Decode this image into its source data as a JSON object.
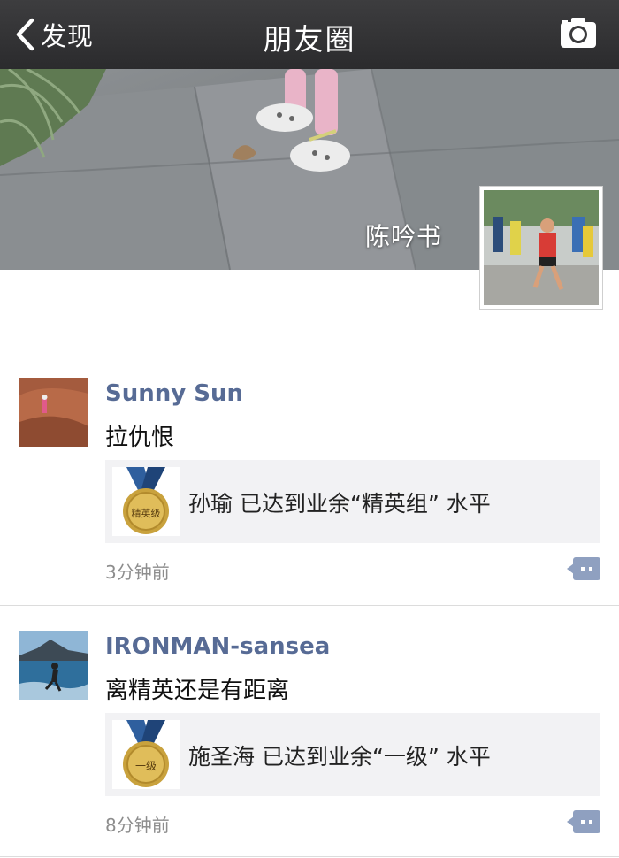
{
  "navbar": {
    "back_label": "发现",
    "title": "朋友圈",
    "camera_icon": "camera-icon"
  },
  "cover": {
    "owner_name": "陈吟书"
  },
  "posts": [
    {
      "username": "Sunny Sun",
      "text": "拉仇恨",
      "share_text": "孙瑜 已达到业余“精英组” 水平",
      "medal_label": "精英级",
      "time": "3分钟前"
    },
    {
      "username": "IRONMAN-sansea",
      "text": "离精英还是有距离",
      "share_text": "施圣海 已达到业余“一级” 水平",
      "medal_label": "一级",
      "time": "8分钟前"
    }
  ],
  "colors": {
    "navbar_bg": "#2f2f31",
    "username": "#576b95",
    "card_bg": "#f2f2f4",
    "comment_icon": "#8fa0c0"
  }
}
